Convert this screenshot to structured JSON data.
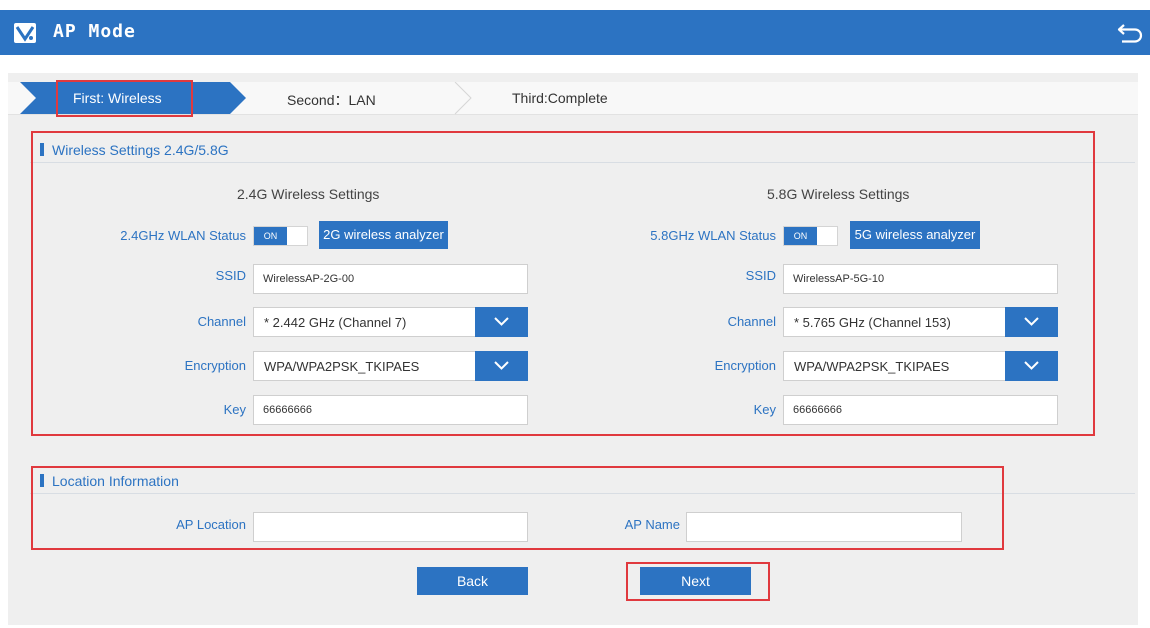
{
  "header": {
    "title": "AP Mode"
  },
  "steps": [
    {
      "label": "First: Wireless"
    },
    {
      "label": "Second：LAN"
    },
    {
      "label": "Third:Complete"
    }
  ],
  "wireless": {
    "section_title": "Wireless Settings 2.4G/5.8G",
    "band24": {
      "title": "2.4G Wireless Settings",
      "status_label": "2.4GHz WLAN Status",
      "toggle": "ON",
      "analyzer": "2G wireless analyzer",
      "ssid_label": "SSID",
      "ssid": "WirelessAP-2G-00",
      "channel_label": "Channel",
      "channel": "* 2.442 GHz (Channel 7)",
      "encryption_label": "Encryption",
      "encryption": "WPA/WPA2PSK_TKIPAES",
      "key_label": "Key",
      "key": "66666666"
    },
    "band58": {
      "title": "5.8G Wireless Settings",
      "status_label": "5.8GHz WLAN Status",
      "toggle": "ON",
      "analyzer": "5G wireless analyzer",
      "ssid_label": "SSID",
      "ssid": "WirelessAP-5G-10",
      "channel_label": "Channel",
      "channel": "* 5.765 GHz (Channel 153)",
      "encryption_label": "Encryption",
      "encryption": "WPA/WPA2PSK_TKIPAES",
      "key_label": "Key",
      "key": "66666666"
    }
  },
  "location": {
    "section_title": "Location Information",
    "ap_location_label": "AP Location",
    "ap_location": "",
    "ap_name_label": "AP Name",
    "ap_name": ""
  },
  "buttons": {
    "back": "Back",
    "next": "Next"
  },
  "colors": {
    "accent": "#2c73c2",
    "highlight": "#e0393e",
    "panel": "#efefef"
  }
}
